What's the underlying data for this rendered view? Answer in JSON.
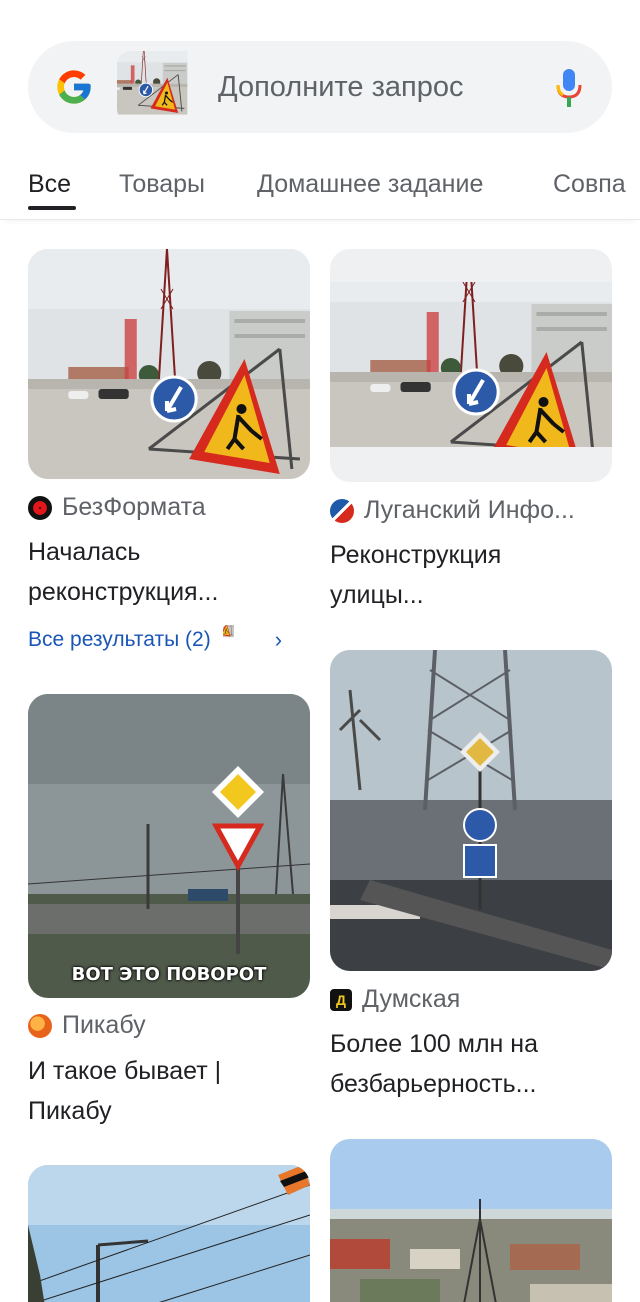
{
  "search": {
    "placeholder": "Дополните запрос"
  },
  "icons": {
    "logo": "google-g-icon",
    "mic": "microphone-icon",
    "chevron": "chevron-right-icon"
  },
  "colors": {
    "link": "#1a56b6",
    "text": "#202124",
    "secondary": "#5f6368"
  },
  "tabs": [
    {
      "label": "Все",
      "active": true
    },
    {
      "label": "Товары",
      "active": false
    },
    {
      "label": "Домашнее задание",
      "active": false
    },
    {
      "label": "Совпа",
      "active": false
    }
  ],
  "results": {
    "col1": [
      {
        "source": "БезФормата",
        "title_line1": "Началась",
        "title_line2": "реконструкция..."
      },
      {
        "caption": "ВОТ ЭТО ПОВОРОТ",
        "source": "Пикабу",
        "title_line1": "И такое бывает |",
        "title_line2": "Пикабу"
      }
    ],
    "col2": [
      {
        "source": "Луганский Инфо...",
        "title_line1": "Реконструкция",
        "title_line2": "улицы..."
      },
      {
        "source": "Думская",
        "favicon_letter": "Д",
        "title_line1": "Более 100 млн на",
        "title_line2": "безбарьерность..."
      }
    ],
    "more_results": "Все результаты (2)"
  }
}
